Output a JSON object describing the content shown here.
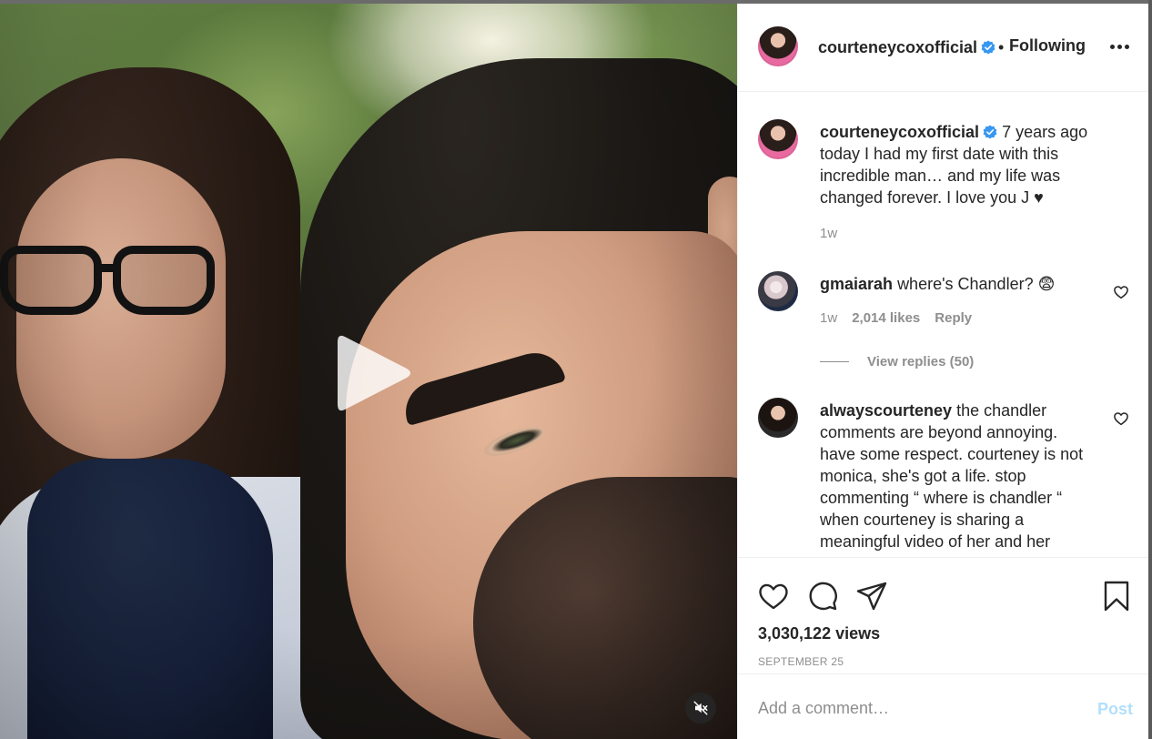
{
  "post": {
    "author": "courteneycoxofficial",
    "follow_status": "Following",
    "separator": "•"
  },
  "caption": {
    "author": "courteneycoxofficial",
    "text": "7 years ago today I had my first date with this incredible man… and my life was changed forever. I love you J ♥",
    "time": "1w"
  },
  "comments": [
    {
      "author": "gmaiarah",
      "text": "where's Chandler? 😨",
      "time": "1w",
      "likes": "2,014 likes",
      "reply_label": "Reply",
      "view_replies": "View replies (50)"
    },
    {
      "author": "alwayscourteney",
      "text": "the chandler comments are beyond annoying. have some respect. courteney is not monica, she's got a life. stop commenting “ where is chandler “ when courteney is sharing a meaningful video of her and her"
    }
  ],
  "stats": {
    "views": "3,030,122 views",
    "date": "SEPTEMBER 25"
  },
  "composer": {
    "placeholder": "Add a comment…",
    "post_label": "Post"
  },
  "colors": {
    "verified": "#3897f0",
    "post_disabled": "#b2dffc",
    "muted_text": "#8e8e8e"
  },
  "icons": {
    "like": "heart-icon",
    "comment": "comment-bubble-icon",
    "share": "paper-plane-icon",
    "save": "bookmark-icon",
    "play": "play-icon",
    "mute": "speaker-muted-icon",
    "more": "more-options-icon",
    "verified": "verified-badge-icon"
  }
}
